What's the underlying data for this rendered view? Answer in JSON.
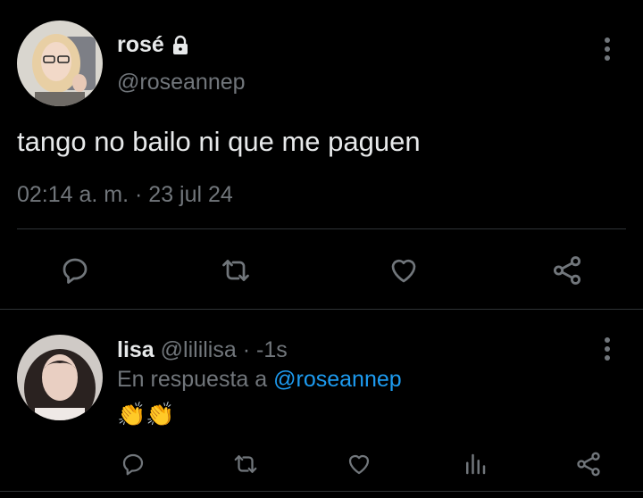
{
  "main_tweet": {
    "display_name": "rosé",
    "lock_icon": "lock-icon",
    "handle": "@roseannep",
    "text": "tango no bailo ni que me paguen",
    "timestamp": "02:14 a. m. · 23 jul 24",
    "actions": [
      "reply-icon",
      "retweet-icon",
      "like-icon",
      "share-icon"
    ]
  },
  "reply_tweet": {
    "display_name": "lisa",
    "handle": "@lililisa",
    "time": "· -1s",
    "reply_prefix": "En respuesta a",
    "reply_to": "@roseannep",
    "text": "👏👏",
    "actions": [
      "reply-icon",
      "retweet-icon",
      "like-icon",
      "stats-icon",
      "share-icon"
    ]
  },
  "colors": {
    "background": "#000000",
    "text": "#e7e9ea",
    "muted": "#71767b",
    "link": "#1d9bf0",
    "divider": "#2f3336"
  }
}
